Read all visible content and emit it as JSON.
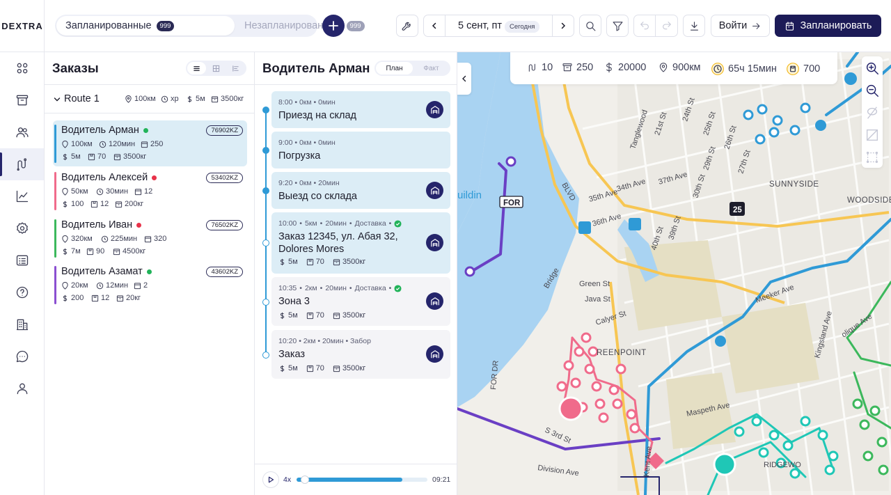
{
  "brand": {
    "logo": "DEXTRA"
  },
  "header": {
    "tab_scheduled": "Запланированные",
    "tab_scheduled_count": "999",
    "tab_unscheduled": "Незапланированные",
    "tab_unscheduled_count": "999",
    "date": "5 сент, пт",
    "today": "Сегодня",
    "login": "Войти",
    "schedule": "Запланировать"
  },
  "nav": {
    "icons": [
      "apps-icon",
      "archive-icon",
      "users-icon",
      "routes-icon",
      "analytics-icon",
      "settings-icon",
      "list-icon",
      "help-icon",
      "buildings-icon",
      "chat-icon",
      "profile-icon"
    ],
    "active": "routes-icon"
  },
  "orders": {
    "title": "Заказы",
    "route": {
      "name": "Route 1",
      "distance": "100км",
      "time": "xp",
      "cost": "5м",
      "weight": "3500кг"
    },
    "drivers": [
      {
        "name": "Водитель Арман",
        "status_color": "#22b35a",
        "plate": "76902KZ",
        "distance": "100км",
        "time": "120мин",
        "orders": "250",
        "cost": "5м",
        "boxes": "70",
        "weight": "3500кг",
        "bar_color": "#2f9ad6"
      },
      {
        "name": "Водитель Алексей",
        "status_color": "#e8334a",
        "plate": "53402KZ",
        "distance": "50км",
        "time": "30мин",
        "orders": "12",
        "cost": "100",
        "boxes": "12",
        "weight": "200кг",
        "bar_color": "#f06b8b"
      },
      {
        "name": "Водитель Иван",
        "status_color": "#e8334a",
        "plate": "76502KZ",
        "distance": "320км",
        "time": "225мин",
        "orders": "320",
        "cost": "7м",
        "boxes": "90",
        "weight": "4500кг",
        "bar_color": "#3cb85c"
      },
      {
        "name": "Водитель Азамат",
        "status_color": "#22b35a",
        "plate": "43602KZ",
        "distance": "20км",
        "time": "12мин",
        "orders": "2",
        "cost": "200",
        "boxes": "12",
        "weight": "20кг",
        "bar_color": "#8b4fd1"
      }
    ]
  },
  "timeline": {
    "title": "Водитель Арман",
    "toggle_plan": "План",
    "toggle_fact": "Факт",
    "stops": [
      {
        "time": "8:00",
        "dist": "0км",
        "dur": "0мин",
        "title": "Приезд на склад"
      },
      {
        "time": "9:00",
        "dist": "0км",
        "dur": "0мин",
        "title": "Погрузка"
      },
      {
        "time": "9:20",
        "dist": "0км",
        "dur": "20мин",
        "title": "Выезд со склада"
      },
      {
        "time": "10:00",
        "dist": "5км",
        "dur": "20мин",
        "type": "Доставка",
        "title": "Заказ 12345, ул. Абая 32, Dolores Mores",
        "cost": "5м",
        "boxes": "70",
        "weight": "3500кг"
      },
      {
        "time": "10:35",
        "dist": "2км",
        "dur": "20мин",
        "type": "Доставка",
        "title": "Зона 3",
        "cost": "5м",
        "boxes": "70",
        "weight": "3500кг"
      },
      {
        "time": "10:20",
        "dist": "2км",
        "dur": "20мин",
        "type": "Забор",
        "title": "Заказ",
        "cost": "5м",
        "boxes": "70",
        "weight": "3500кг"
      }
    ],
    "player": {
      "speed": "4x",
      "time": "09:21",
      "progress": 0.81
    }
  },
  "map": {
    "stats": {
      "routes": "10",
      "orders": "250",
      "cost": "20000",
      "distance": "900км",
      "duration": "65ч 15мин",
      "capacity": "700"
    },
    "labels": {
      "sunnyside": "SUNNYSIDE",
      "woodside": "WOODSIDE",
      "greenpoint": "REENPOINT",
      "green_st": "Green St",
      "java_st": "Java St",
      "calyer_st": "Calyer St",
      "maspeth": "Maspeth Ave",
      "division": "Division Ave",
      "s3rd": "S 3rd St",
      "ave34": "34th Ave",
      "st40": "40th St",
      "st39": "39th St",
      "st30": "30th St",
      "ave35": "35th Ave",
      "ave36": "36th Ave",
      "ave37": "37th Ave",
      "st21": "21st St",
      "st24": "24th St",
      "st25": "25th St",
      "st26": "26th St",
      "st27": "27th St",
      "st29": "29th St",
      "for": "FOR",
      "shield": "25",
      "building": "uildin",
      "blvd": "BLVD",
      "bridge": "Bridge",
      "tanglewood": "Tanglewood",
      "fordr": "FOR DR",
      "kent": "Kent Ave",
      "ridge": "RIDGEWO",
      "olique": "olique Ave",
      "kingsland": "Kingsland Ave",
      "meeker": "Meeker Ave"
    },
    "colors": {
      "water": "#a9d3f2",
      "route_blue": "#2f9ad6",
      "route_purple": "#6a3fc4",
      "route_pink": "#f06b8b",
      "route_green": "#3cb85c",
      "route_teal": "#1fc7b6"
    }
  }
}
